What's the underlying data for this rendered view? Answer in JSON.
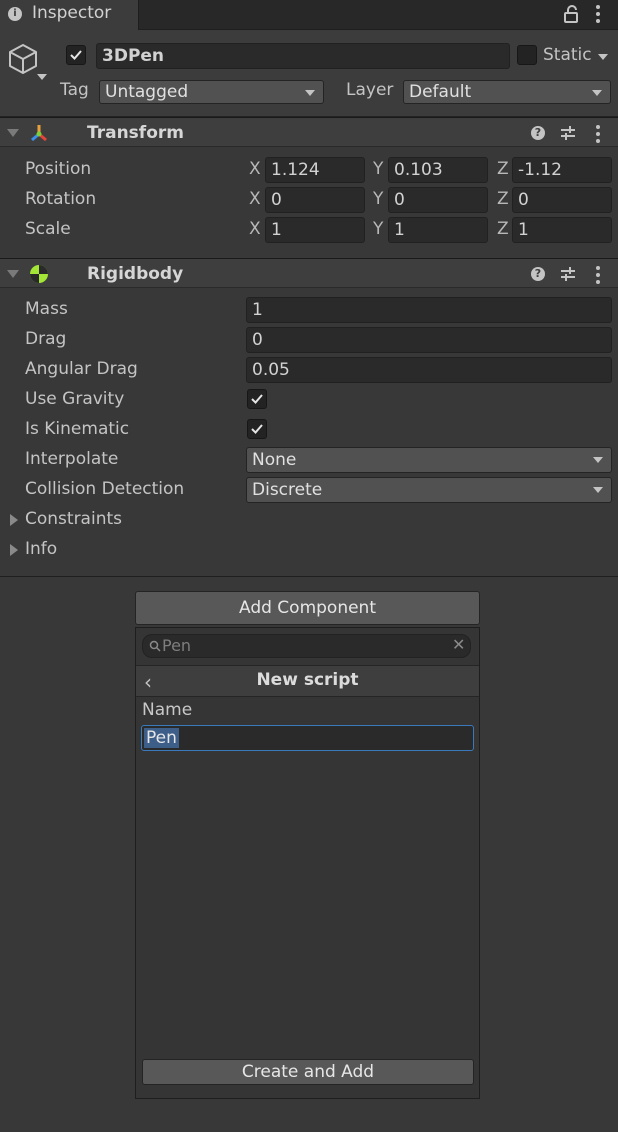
{
  "tab": {
    "title": "Inspector",
    "icon": "info-icon"
  },
  "object": {
    "active": true,
    "name": "3DPen",
    "static_label": "Static",
    "static_checked": false,
    "tag_label": "Tag",
    "tag_value": "Untagged",
    "layer_label": "Layer",
    "layer_value": "Default"
  },
  "transform": {
    "title": "Transform",
    "rows": [
      {
        "label": "Position",
        "x": "1.124",
        "y": "0.103",
        "z": "-1.12"
      },
      {
        "label": "Rotation",
        "x": "0",
        "y": "0",
        "z": "0"
      },
      {
        "label": "Scale",
        "x": "1",
        "y": "1",
        "z": "1"
      }
    ],
    "axis_x": "X",
    "axis_y": "Y",
    "axis_z": "Z"
  },
  "rigidbody": {
    "title": "Rigidbody",
    "mass_label": "Mass",
    "mass": "1",
    "drag_label": "Drag",
    "drag": "0",
    "angular_drag_label": "Angular Drag",
    "angular_drag": "0.05",
    "use_gravity_label": "Use Gravity",
    "use_gravity": true,
    "is_kinematic_label": "Is Kinematic",
    "is_kinematic": true,
    "interpolate_label": "Interpolate",
    "interpolate": "None",
    "collision_label": "Collision Detection",
    "collision": "Discrete",
    "constraints_label": "Constraints",
    "info_label": "Info"
  },
  "add_component": {
    "button_label": "Add Component",
    "search_value": "Pen",
    "panel_title": "New script",
    "name_label": "Name",
    "name_value": "Pen",
    "create_label": "Create and Add"
  },
  "colors": {
    "background": "#383838",
    "transform_axis_x": "#e2463a",
    "transform_axis_y": "#7ccf34",
    "transform_axis_z": "#3c8ee6",
    "rigidbody_icon": "#a3e635",
    "selection": "#3e5e8a"
  }
}
